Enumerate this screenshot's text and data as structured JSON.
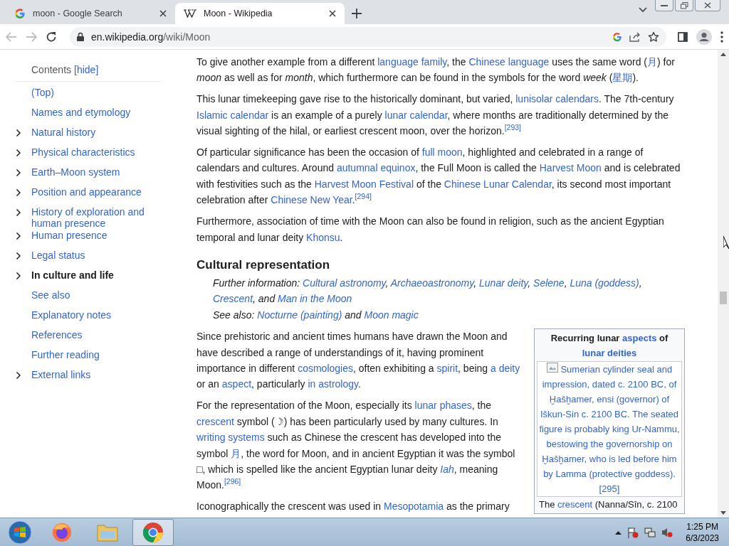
{
  "tabs": [
    {
      "kind": "google",
      "title": "moon - Google Search",
      "selected": false
    },
    {
      "kind": "wikipedia",
      "title": "Moon - Wikipedia",
      "selected": true
    }
  ],
  "address": {
    "domain": "en.wikipedia.org",
    "path": "/wiki/Moon"
  },
  "toc": {
    "title": "Contents",
    "hide": "[hide]",
    "items": [
      {
        "label": "(Top)",
        "expandable": false,
        "selected": false
      },
      {
        "label": "Names and etymology",
        "expandable": false,
        "selected": false
      },
      {
        "label": "Natural history",
        "expandable": true,
        "selected": false
      },
      {
        "label": "Physical characteristics",
        "expandable": true,
        "selected": false
      },
      {
        "label": "Earth–Moon system",
        "expandable": true,
        "selected": false
      },
      {
        "label": "Position and appearance",
        "expandable": true,
        "selected": false
      },
      {
        "label": "History of exploration and human presence",
        "expandable": true,
        "selected": false
      },
      {
        "label": "Human presence",
        "expandable": true,
        "selected": false
      },
      {
        "label": "Legal status",
        "expandable": true,
        "selected": false
      },
      {
        "label": "In culture and life",
        "expandable": true,
        "selected": true
      },
      {
        "label": "See also",
        "expandable": false,
        "selected": false
      },
      {
        "label": "Explanatory notes",
        "expandable": false,
        "selected": false
      },
      {
        "label": "References",
        "expandable": false,
        "selected": false
      },
      {
        "label": "Further reading",
        "expandable": false,
        "selected": false
      },
      {
        "label": "External links",
        "expandable": true,
        "selected": false
      }
    ]
  },
  "article": [
    {
      "kind": "para",
      "segs": [
        {
          "kind": "text",
          "x": "To give another example from a different "
        },
        {
          "kind": "link",
          "x": "language family"
        },
        {
          "kind": "text",
          "x": ", the "
        },
        {
          "kind": "link",
          "x": "Chinese language"
        },
        {
          "kind": "text",
          "x": " uses the same word ("
        },
        {
          "kind": "link",
          "x": "月"
        },
        {
          "kind": "text",
          "x": ") for "
        },
        {
          "kind": "italic",
          "x": "moon"
        },
        {
          "kind": "text",
          "x": " as well as for "
        },
        {
          "kind": "italic",
          "x": "month"
        },
        {
          "kind": "text",
          "x": ", which furthermore can be found in the symbols for the word "
        },
        {
          "kind": "italic",
          "x": "week"
        },
        {
          "kind": "text",
          "x": " ("
        },
        {
          "kind": "link",
          "x": "星期"
        },
        {
          "kind": "text",
          "x": ")."
        }
      ]
    },
    {
      "kind": "para",
      "segs": [
        {
          "kind": "text",
          "x": "This lunar timekeeping gave rise to the historically dominant, but varied, "
        },
        {
          "kind": "link",
          "x": "lunisolar calendars"
        },
        {
          "kind": "text",
          "x": ". The 7th-century "
        },
        {
          "kind": "link",
          "x": "Islamic calendar"
        },
        {
          "kind": "text",
          "x": " is an example of a purely "
        },
        {
          "kind": "link",
          "x": "lunar calendar"
        },
        {
          "kind": "text",
          "x": ", where months are traditionally determined by the visual sighting of the hilal, or earliest crescent moon, over the horizon."
        },
        {
          "kind": "ref",
          "x": "[293]"
        }
      ]
    },
    {
      "kind": "para",
      "segs": [
        {
          "kind": "text",
          "x": "Of particular significance has been the occasion of "
        },
        {
          "kind": "link",
          "x": "full moon"
        },
        {
          "kind": "text",
          "x": ", highlighted and celebrated in a range of calendars and cultures. Around "
        },
        {
          "kind": "link",
          "x": "autumnal equinox"
        },
        {
          "kind": "text",
          "x": ", the Full Moon is called the "
        },
        {
          "kind": "link",
          "x": "Harvest Moon"
        },
        {
          "kind": "text",
          "x": " and is celebrated with festivities such as the "
        },
        {
          "kind": "link",
          "x": "Harvest Moon Festival"
        },
        {
          "kind": "text",
          "x": " of the "
        },
        {
          "kind": "link",
          "x": "Chinese Lunar Calendar"
        },
        {
          "kind": "text",
          "x": ", its second most important celebration after "
        },
        {
          "kind": "link",
          "x": "Chinese New Year"
        },
        {
          "kind": "text",
          "x": "."
        },
        {
          "kind": "ref",
          "x": "[294]"
        }
      ]
    },
    {
      "kind": "para",
      "segs": [
        {
          "kind": "text",
          "x": "Furthermore, association of time with the Moon can also be found in religion, such as the ancient Egyptian temporal and lunar deity "
        },
        {
          "kind": "link",
          "x": "Khonsu"
        },
        {
          "kind": "text",
          "x": "."
        }
      ]
    },
    {
      "kind": "heading",
      "text": "Cultural representation"
    },
    {
      "kind": "hatnote",
      "segs": [
        {
          "kind": "text",
          "x": "Further information: "
        },
        {
          "kind": "link",
          "x": "Cultural astronomy"
        },
        {
          "kind": "text",
          "x": ", "
        },
        {
          "kind": "link",
          "x": "Archaeoastronomy"
        },
        {
          "kind": "text",
          "x": ", "
        },
        {
          "kind": "link",
          "x": "Lunar deity"
        },
        {
          "kind": "text",
          "x": ", "
        },
        {
          "kind": "link",
          "x": "Selene"
        },
        {
          "kind": "text",
          "x": ", "
        },
        {
          "kind": "link",
          "x": "Luna (goddess)"
        },
        {
          "kind": "text",
          "x": ", "
        },
        {
          "kind": "link",
          "x": "Crescent"
        },
        {
          "kind": "text",
          "x": ", and "
        },
        {
          "kind": "link",
          "x": "Man in the Moon"
        }
      ]
    },
    {
      "kind": "hatnote",
      "segs": [
        {
          "kind": "text",
          "x": "See also: "
        },
        {
          "kind": "link",
          "x": "Nocturne (painting)"
        },
        {
          "kind": "text",
          "x": " and "
        },
        {
          "kind": "link",
          "x": "Moon magic"
        }
      ]
    },
    {
      "kind": "with_infobox",
      "infobox": {
        "title": [
          {
            "kind": "text",
            "x": "Recurring lunar "
          },
          {
            "kind": "link",
            "x": "aspects"
          },
          {
            "kind": "text",
            "x": " of "
          },
          {
            "kind": "link",
            "x": "lunar deities"
          }
        ],
        "caption": "Sumerian cylinder seal and impression, dated c. 2100 BC, of Ḫašḫamer, ensi (governor) of Iškun-Sin c. 2100 BC. The seated figure is probably king Ur-Nammu, bestowing the governorship on Ḫašḫamer, who is led before him by Lamma (protective goddess).",
        "caption_ref": "[295]",
        "footer": [
          {
            "kind": "text",
            "x": "The "
          },
          {
            "kind": "link",
            "x": "crescent"
          },
          {
            "kind": "text",
            "x": " (Nanna/Sîn, c. 2100"
          }
        ]
      },
      "paras": [
        {
          "kind": "para",
          "segs": [
            {
              "kind": "text",
              "x": "Since prehistoric and ancient times humans have drawn the Moon and have described a range of understandings of it, having prominent importance in different "
            },
            {
              "kind": "link",
              "x": "cosmologies"
            },
            {
              "kind": "text",
              "x": ", often exhibiting a "
            },
            {
              "kind": "link",
              "x": "spirit"
            },
            {
              "kind": "text",
              "x": ", being "
            },
            {
              "kind": "link",
              "x": "a deity"
            },
            {
              "kind": "text",
              "x": " or an "
            },
            {
              "kind": "link",
              "x": "aspect"
            },
            {
              "kind": "text",
              "x": ", particularly "
            },
            {
              "kind": "link",
              "x": "in astrology"
            },
            {
              "kind": "text",
              "x": "."
            }
          ]
        },
        {
          "kind": "para",
          "segs": [
            {
              "kind": "text",
              "x": "For the representation of the Moon, especially its "
            },
            {
              "kind": "link",
              "x": "lunar phases"
            },
            {
              "kind": "text",
              "x": ", the "
            },
            {
              "kind": "link",
              "x": "crescent"
            },
            {
              "kind": "text",
              "x": " symbol (☽) has been particularly used by many cultures. In "
            },
            {
              "kind": "link",
              "x": "writing systems"
            },
            {
              "kind": "text",
              "x": " such as Chinese the crescent has developed into the symbol "
            },
            {
              "kind": "link",
              "x": "月"
            },
            {
              "kind": "text",
              "x": ", the word for Moon, and in ancient Egyptian it was the symbol □, which is spelled like the ancient Egyptian lunar deity "
            },
            {
              "kind": "italic_link",
              "x": "Iah"
            },
            {
              "kind": "text",
              "x": ", meaning Moon."
            },
            {
              "kind": "ref",
              "x": "[296]"
            }
          ]
        },
        {
          "kind": "para",
          "segs": [
            {
              "kind": "text",
              "x": "Iconographically the crescent was used in "
            },
            {
              "kind": "link",
              "x": "Mesopotamia"
            },
            {
              "kind": "text",
              "x": " as the primary"
            }
          ]
        }
      ]
    }
  ],
  "taskbar": {
    "apps": [
      {
        "kind": "firefox",
        "selected": false
      },
      {
        "kind": "folder",
        "selected": false
      },
      {
        "kind": "chrome",
        "selected": true
      }
    ],
    "time": "1:25 PM",
    "date": "6/3/2023"
  }
}
